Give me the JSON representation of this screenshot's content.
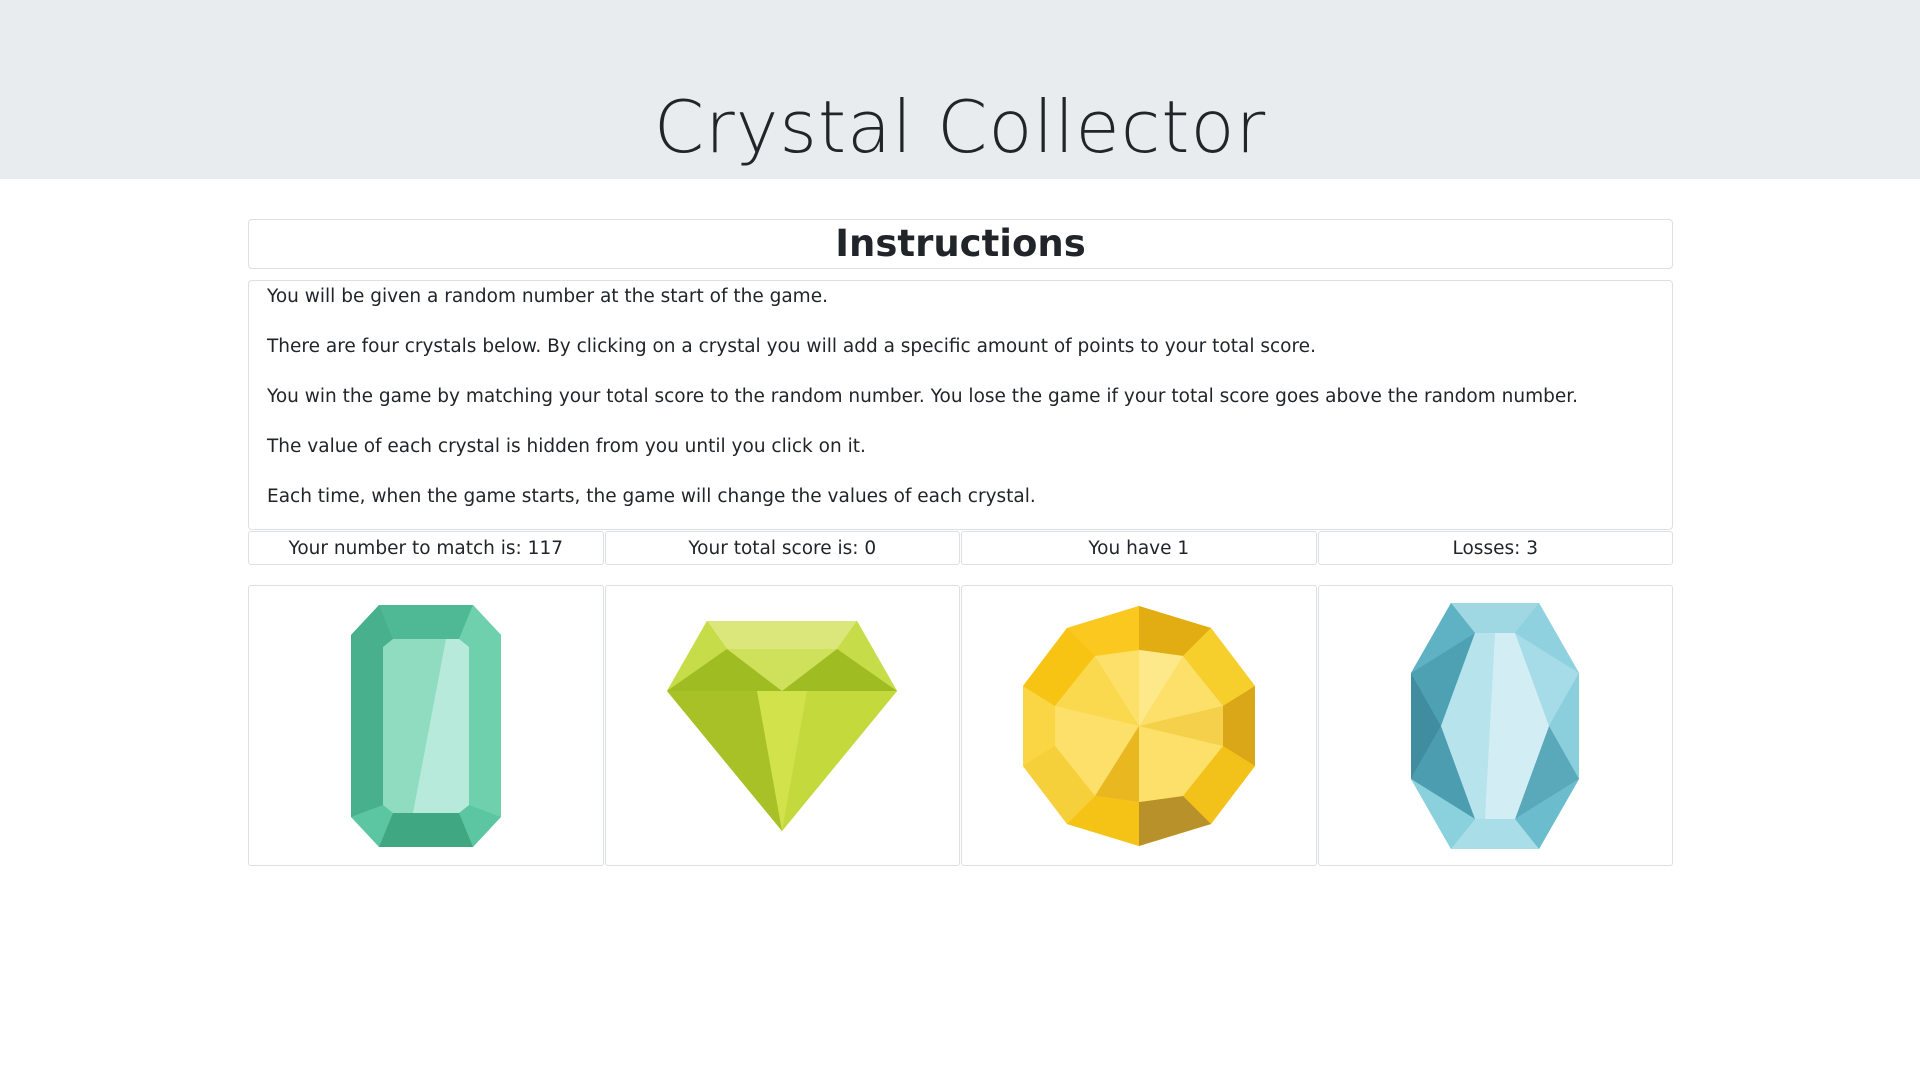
{
  "header": {
    "title": "Crystal Collector"
  },
  "instructions": {
    "title": "Instructions",
    "lines": [
      "You will be given a random number at the start of the game.",
      "There are four crystals below. By clicking on a crystal you will add a specific amount of points to your total score.",
      "You win the game by matching your total score to the random number. You lose the game if your total score goes above the random number.",
      "The value of each crystal is hidden from you until you click on it.",
      "Each time, when the game starts, the game will change the values of each crystal."
    ]
  },
  "stats": {
    "target": "Your number to match is: 117",
    "score": "Your total score is: 0",
    "wins": "You have 1",
    "losses": "Losses: 3"
  },
  "crystals": [
    {
      "icon": "green-emerald-crystal-icon",
      "color": "#5cc6a2"
    },
    {
      "icon": "lime-diamond-crystal-icon",
      "color": "#b5cf2c"
    },
    {
      "icon": "yellow-round-crystal-icon",
      "color": "#f8c414"
    },
    {
      "icon": "blue-oval-crystal-icon",
      "color": "#79c9d8"
    }
  ]
}
